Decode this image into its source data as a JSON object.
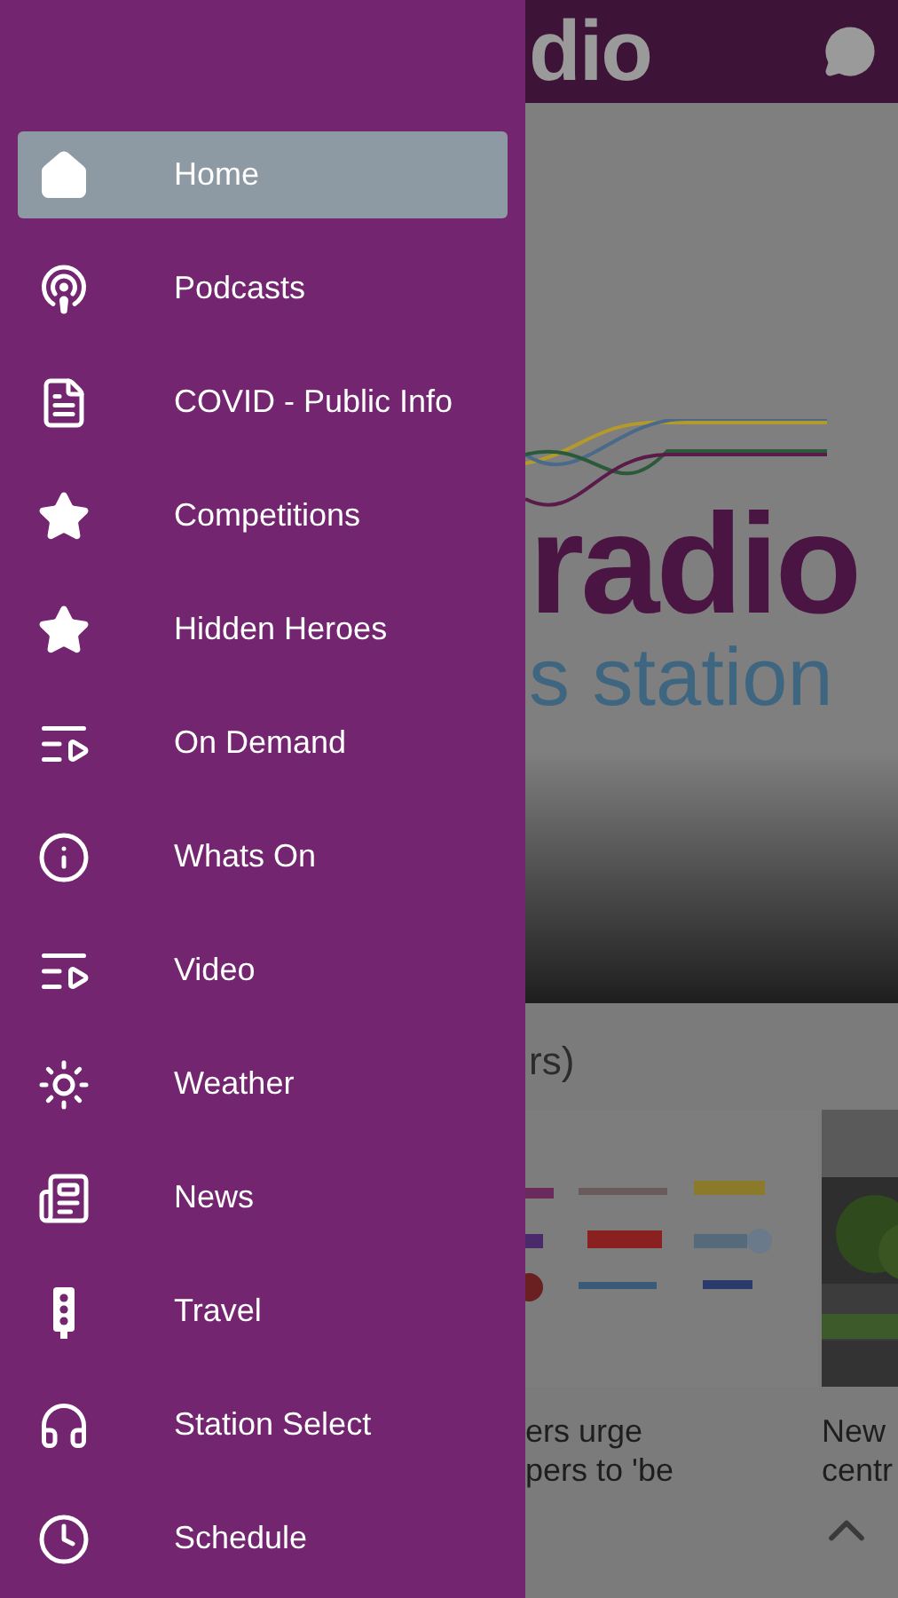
{
  "drawer": {
    "items": [
      {
        "label": "Home",
        "selected": true
      },
      {
        "label": "Podcasts",
        "selected": false
      },
      {
        "label": "COVID - Public Info",
        "selected": false
      },
      {
        "label": "Competitions",
        "selected": false
      },
      {
        "label": "Hidden Heroes",
        "selected": false
      },
      {
        "label": "On Demand",
        "selected": false
      },
      {
        "label": "Whats On",
        "selected": false
      },
      {
        "label": "Video",
        "selected": false
      },
      {
        "label": "Weather",
        "selected": false
      },
      {
        "label": "News",
        "selected": false
      },
      {
        "label": "Travel",
        "selected": false
      },
      {
        "label": "Station Select",
        "selected": false
      },
      {
        "label": "Schedule",
        "selected": false
      }
    ]
  },
  "background": {
    "header_logo": "dio",
    "hero_logo": "radio",
    "hero_tagline": "s station",
    "section_title": "rs)",
    "cards": [
      {
        "title": "ers urge\npers to 'be"
      },
      {
        "title": "New\ncentr"
      }
    ]
  }
}
